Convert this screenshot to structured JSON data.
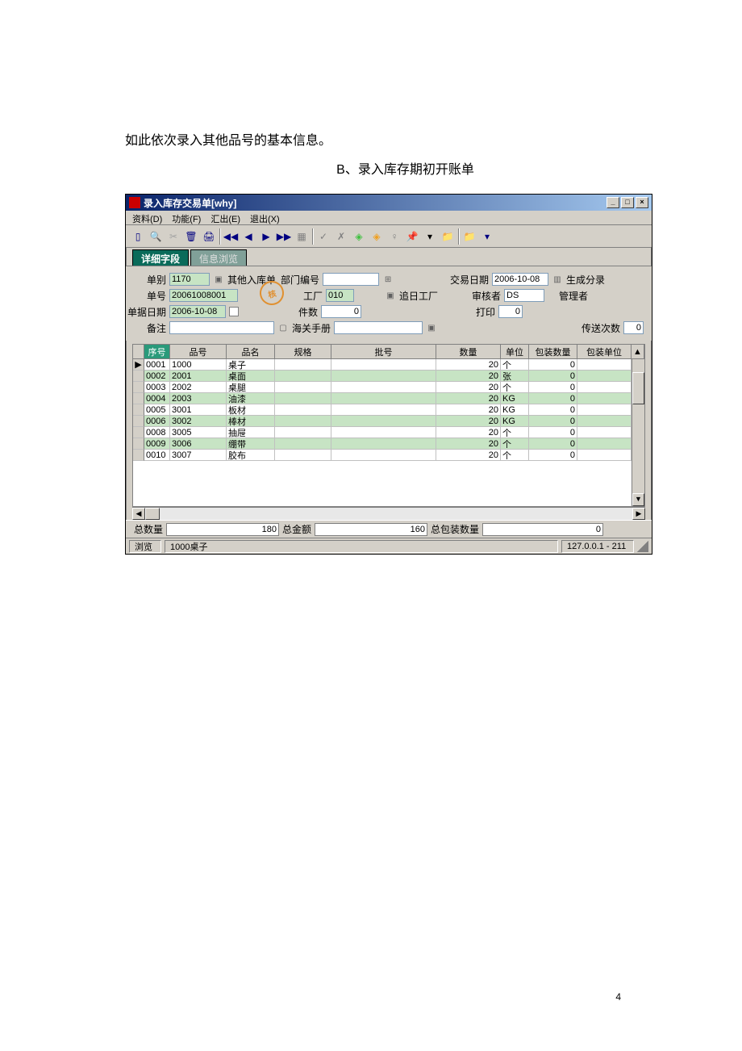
{
  "doc": {
    "line1": "如此依次录入其他品号的基本信息。",
    "line2": "B、录入库存期初开账单",
    "page_num": "4"
  },
  "window": {
    "title": "录入库存交易单[why]",
    "menus": [
      "资料(D)",
      "功能(F)",
      "汇出(E)",
      "退出(X)"
    ],
    "tabs": {
      "active": "详细字段",
      "inactive": "信息浏览"
    }
  },
  "form": {
    "labels": {
      "danbie": "单别",
      "danbie_btn": "其他入库单",
      "bumen": "部门编号",
      "jyrq": "交易日期",
      "sheng": "生成分录",
      "danhao": "单号",
      "gongchang": "工厂",
      "zhuichang": "追日工厂",
      "shenhe": "审核者",
      "guanli": "管理者",
      "djrq": "单据日期",
      "jianshu": "件数",
      "dayin": "打印",
      "beizhu": "备注",
      "haiguan": "海关手册",
      "chuansong": "传送次数"
    },
    "values": {
      "danbie": "1170",
      "bumen": "",
      "jyrq": "2006-10-08",
      "danhao": "20061008001",
      "gongchang": "010",
      "shenhe": "DS",
      "guanli": "",
      "djrq": "2006-10-08",
      "jianshu": "0",
      "dayin": "0",
      "beizhu": "",
      "haiguan": "",
      "chuansong": "0"
    }
  },
  "grid": {
    "headers": [
      "序号",
      "品号",
      "品名",
      "规格",
      "批号",
      "数量",
      "单位",
      "包装数量",
      "包装单位"
    ],
    "rows": [
      {
        "seq": "0001",
        "ph": "1000",
        "pm": "桌子",
        "gg": "",
        "bh": "",
        "sl": "20",
        "dw": "个",
        "bzsl": "0",
        "bzdw": ""
      },
      {
        "seq": "0002",
        "ph": "2001",
        "pm": "桌面",
        "gg": "",
        "bh": "",
        "sl": "20",
        "dw": "张",
        "bzsl": "0",
        "bzdw": ""
      },
      {
        "seq": "0003",
        "ph": "2002",
        "pm": "桌腿",
        "gg": "",
        "bh": "",
        "sl": "20",
        "dw": "个",
        "bzsl": "0",
        "bzdw": ""
      },
      {
        "seq": "0004",
        "ph": "2003",
        "pm": "油漆",
        "gg": "",
        "bh": "",
        "sl": "20",
        "dw": "KG",
        "bzsl": "0",
        "bzdw": ""
      },
      {
        "seq": "0005",
        "ph": "3001",
        "pm": "板材",
        "gg": "",
        "bh": "",
        "sl": "20",
        "dw": "KG",
        "bzsl": "0",
        "bzdw": ""
      },
      {
        "seq": "0006",
        "ph": "3002",
        "pm": "棒材",
        "gg": "",
        "bh": "",
        "sl": "20",
        "dw": "KG",
        "bzsl": "0",
        "bzdw": ""
      },
      {
        "seq": "0008",
        "ph": "3005",
        "pm": "抽屉",
        "gg": "",
        "bh": "",
        "sl": "20",
        "dw": "个",
        "bzsl": "0",
        "bzdw": ""
      },
      {
        "seq": "0009",
        "ph": "3006",
        "pm": "绷带",
        "gg": "",
        "bh": "",
        "sl": "20",
        "dw": "个",
        "bzsl": "0",
        "bzdw": ""
      },
      {
        "seq": "0010",
        "ph": "3007",
        "pm": "胶布",
        "gg": "",
        "bh": "",
        "sl": "20",
        "dw": "个",
        "bzsl": "0",
        "bzdw": ""
      }
    ]
  },
  "totals": {
    "zsl_label": "总数量",
    "zsl": "180",
    "zje_label": "总金额",
    "zje": "160",
    "zbz_label": "总包装数量",
    "zbz": "0"
  },
  "status": {
    "mode": "浏览",
    "current": "1000桌子",
    "host": "127.0.0.1 - 211"
  }
}
